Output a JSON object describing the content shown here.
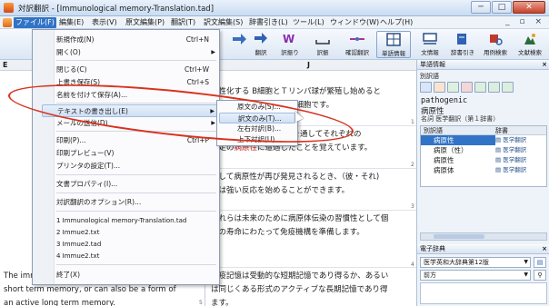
{
  "window": {
    "title": "対訳翻訳 - [Immunological memory-Translation.tad]",
    "controls": [
      "─",
      "□",
      "✕"
    ]
  },
  "menubar": {
    "items": [
      "ファイル(F)",
      "編集(E)",
      "表示(V)",
      "原文編集(P)",
      "翻訳(T)",
      "訳文編集(S)",
      "辞書引き(L)",
      "ツール(L)",
      "ウィンドウ(W)",
      "ヘルプ(H)"
    ],
    "mdi_controls": "_ ▫ ×"
  },
  "toolbar": {
    "buttons": [
      {
        "label": "",
        "icon": "arrow-icon"
      },
      {
        "label": "翻訳",
        "icon": "translate-icon"
      },
      {
        "label": "訳振り",
        "icon": "translate-all-icon"
      },
      {
        "label": "訳振",
        "icon": "word-space-icon"
      },
      {
        "label": "確認翻訳",
        "icon": "confirm-translate-icon"
      },
      {
        "label": "単語情報",
        "icon": "word-info-icon"
      },
      {
        "label": "文情報",
        "icon": "sentence-info-icon"
      },
      {
        "label": "辞書引き",
        "icon": "dictionary-lookup-icon"
      },
      {
        "label": "用例検索",
        "icon": "example-search-icon"
      },
      {
        "label": "文献検索",
        "icon": "document-search-icon"
      }
    ]
  },
  "editor": {
    "col_e": "E",
    "col_j": "J",
    "jp_lines": [
      {
        "pre": "新性化する B細胞とＴリンパ球が繁殖し始めると",
        "red": "",
        "post": ""
      },
      {
        "pre": "",
        "red": "",
        "post": "は、今後の為の免疫記憶細胞です。"
      },
      {
        "pre": "",
        "red": "",
        "post": "の寿命を通してそれぞれの"
      },
      {
        "pre": "特定の",
        "red": "病原性",
        "post": "に遭遇したことを覚えています。"
      },
      {
        "pre": "として病原性が再び発見されるとき、（彼・それ)",
        "red": "",
        "post": ""
      },
      {
        "pre": "らは強い反応を始めることができます。",
        "red": "",
        "post": ""
      },
      {
        "pre": "これらは未来のために病原体伝染の習慣性として個",
        "red": "",
        "post": ""
      },
      {
        "pre": "人の寿命にわたって免疫機構を準備します。",
        "red": "",
        "post": ""
      },
      {
        "pre": "免疫記憶は受動的な短期記憶であり得るか、あるい",
        "red": "",
        "post": ""
      },
      {
        "pre": "は同じくある形式のアクティブな長期記憶であり得",
        "red": "",
        "post": ""
      },
      {
        "pre": "ます。",
        "red": "",
        "post": ""
      }
    ],
    "en_lines": [
      "The immunological memory can be a passive",
      "short term memory, or can also be a form of",
      "an active long term memory."
    ],
    "page_numbers": [
      "1",
      "2",
      "3",
      "4",
      "5"
    ]
  },
  "side_panel": {
    "word_info_title": "単語情報",
    "close": "×",
    "section_label": "別訳語",
    "word": "pathogenic",
    "word_ja": "病原性",
    "source": "名詞 医学翻訳（第１辞書）",
    "table_headers": [
      "別訳語",
      "辞書"
    ],
    "synonyms": [
      {
        "word": "病原性",
        "dict": "医学翻訳",
        "selected": true
      },
      {
        "word": "病原（性）",
        "dict": "医学翻訳",
        "selected": false
      },
      {
        "word": "病原性",
        "dict": "医学翻訳",
        "selected": false
      },
      {
        "word": "病原体",
        "dict": "医学翻訳",
        "selected": false
      }
    ],
    "dict_panel_title": "電子辞典",
    "dict_select": "医学英和大辞典第12版",
    "match_select": "前方"
  },
  "file_menu": {
    "items": [
      {
        "label": "新規作成(N)",
        "shortcut": "Ctrl+N",
        "sub": false,
        "disabled": false
      },
      {
        "label": "開く(O)",
        "shortcut": "",
        "sub": true,
        "disabled": false
      },
      {
        "label": "閉じる(C)",
        "shortcut": "Ctrl+W",
        "sub": false,
        "disabled": false
      },
      {
        "label": "上書き保存(S)",
        "shortcut": "Ctrl+S",
        "sub": false,
        "disabled": false
      },
      {
        "label": "名前を付けて保存(A)...",
        "shortcut": "",
        "sub": false,
        "disabled": false
      },
      {
        "label": "テキストの書き出し(E)",
        "shortcut": "",
        "sub": true,
        "disabled": false
      },
      {
        "label": "メールの送信(D)",
        "shortcut": "",
        "sub": true,
        "disabled": false
      },
      {
        "label": "印刷(P)...",
        "shortcut": "Ctrl+P",
        "sub": false,
        "disabled": false
      },
      {
        "label": "印刷プレビュー(V)",
        "shortcut": "",
        "sub": false,
        "disabled": false
      },
      {
        "label": "プリンタの設定(T)...",
        "shortcut": "",
        "sub": false,
        "disabled": false
      },
      {
        "label": "文書プロパティ(I)...",
        "shortcut": "",
        "sub": false,
        "disabled": false
      },
      {
        "label": "対訳翻訳のオプション(R)...",
        "shortcut": "",
        "sub": false,
        "disabled": false
      },
      {
        "label": "1 Immunological memory-Translation.tad",
        "shortcut": "",
        "sub": false,
        "disabled": false
      },
      {
        "label": "2 Immue2.txt",
        "shortcut": "",
        "sub": false,
        "disabled": false
      },
      {
        "label": "3 Immue2.tad",
        "shortcut": "",
        "sub": false,
        "disabled": false
      },
      {
        "label": "4 Immue2.txt",
        "shortcut": "",
        "sub": false,
        "disabled": false
      },
      {
        "label": "終了(X)",
        "shortcut": "",
        "sub": false,
        "disabled": false
      }
    ]
  },
  "export_submenu": {
    "items": [
      "原文のみ(S)...",
      "訳文のみ(T)...",
      "左右対訳(B)...",
      "上下対訳(U)..."
    ]
  }
}
